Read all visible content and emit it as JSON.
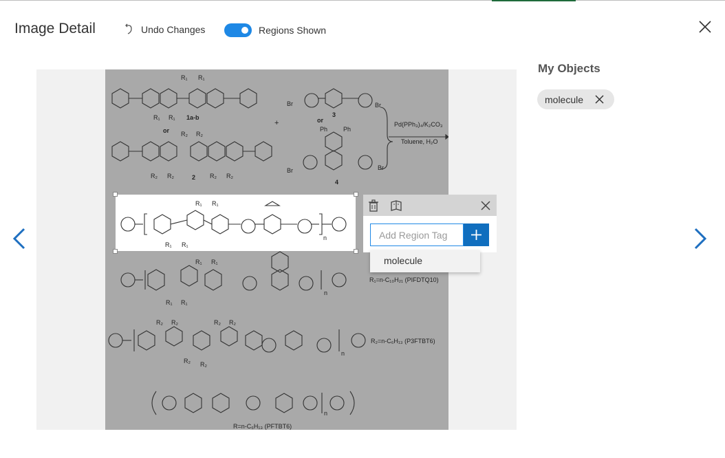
{
  "header": {
    "title": "Image Detail",
    "undo_label": "Undo Changes",
    "toggle_label": "Regions Shown",
    "toggle_on": true
  },
  "colors": {
    "accent": "#1e88e5",
    "add_button": "#106ebe",
    "image_background": "#a9a9a9",
    "canvas_background": "#f1f1f1"
  },
  "icons": {
    "undo": "undo-icon",
    "close": "close-icon",
    "prev": "chevron-left-icon",
    "next": "chevron-right-icon",
    "delete": "trash-icon",
    "copy": "copy-regions-icon",
    "add": "plus-icon",
    "chip_remove": "close-icon"
  },
  "region_popup": {
    "input_placeholder": "Add Region Tag",
    "input_value": "",
    "suggestion": "molecule"
  },
  "sidebar": {
    "title": "My Objects",
    "tags": [
      {
        "label": "molecule"
      }
    ]
  },
  "image_text": {
    "r1": "R₁",
    "r2": "R₂",
    "label_1ab": "1a-b",
    "label_2": "2",
    "label_3": "3",
    "label_4": "4",
    "or": "or",
    "plus": "+",
    "br": "Br",
    "ph": "Ph",
    "reagent": "Pd(PPh₃)₄/K₂CO₃",
    "solvent": "Toluene, H₂O",
    "pifdtq10": "R₁=n-C₁₀H₂₁ (PIFDTQ10)",
    "p3ftbt6": "R₂=n-C₆H₁₃ (P3FTBT6)",
    "pftbt6": "R=n-C₆H₁₃ (PFTBT6)",
    "n": "n"
  }
}
